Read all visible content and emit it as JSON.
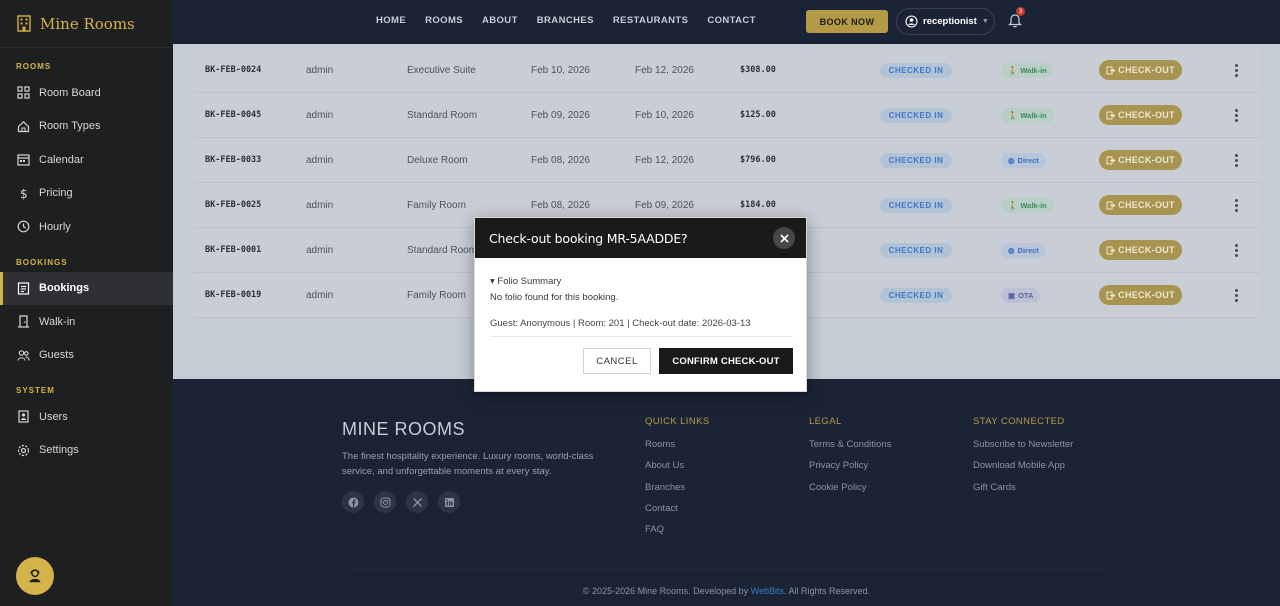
{
  "brand": {
    "name": "Mine Rooms"
  },
  "sidebar": {
    "sections": [
      {
        "label": "ROOMS",
        "items": [
          {
            "label": "Room Board",
            "icon": "grid-icon"
          },
          {
            "label": "Room Types",
            "icon": "home-icon"
          },
          {
            "label": "Calendar",
            "icon": "calendar-icon"
          },
          {
            "label": "Pricing",
            "icon": "dollar-icon"
          },
          {
            "label": "Hourly",
            "icon": "clock-icon"
          }
        ]
      },
      {
        "label": "BOOKINGS",
        "items": [
          {
            "label": "Bookings",
            "icon": "list-icon",
            "active": true
          },
          {
            "label": "Walk-in",
            "icon": "door-icon"
          },
          {
            "label": "Guests",
            "icon": "users-icon"
          }
        ]
      },
      {
        "label": "SYSTEM",
        "items": [
          {
            "label": "Users",
            "icon": "user-card-icon"
          },
          {
            "label": "Settings",
            "icon": "gear-icon"
          }
        ]
      }
    ]
  },
  "topnav": {
    "links": [
      "HOME",
      "ROOMS",
      "ABOUT",
      "BRANCHES",
      "RESTAURANTS",
      "CONTACT"
    ],
    "book_now": "BOOK NOW",
    "user": "receptionist",
    "notifications": "3"
  },
  "bookings": [
    {
      "code": "BK-FEB-0024",
      "user": "admin",
      "room": "Executive Suite",
      "check_in": "Feb 10, 2026",
      "check_out": "Feb 12, 2026",
      "amount": "$308.00",
      "status": "CHECKED IN",
      "source": "Walk-in",
      "source_type": "walk",
      "action": "CHECK-OUT"
    },
    {
      "code": "BK-FEB-0045",
      "user": "admin",
      "room": "Standard Room",
      "check_in": "Feb 09, 2026",
      "check_out": "Feb 10, 2026",
      "amount": "$125.00",
      "status": "CHECKED IN",
      "source": "Walk-in",
      "source_type": "walk",
      "action": "CHECK-OUT"
    },
    {
      "code": "BK-FEB-0033",
      "user": "admin",
      "room": "Deluxe Room",
      "check_in": "Feb 08, 2026",
      "check_out": "Feb 12, 2026",
      "amount": "$796.00",
      "status": "CHECKED IN",
      "source": "Direct",
      "source_type": "direct",
      "action": "CHECK-OUT"
    },
    {
      "code": "BK-FEB-0025",
      "user": "admin",
      "room": "Family Room",
      "check_in": "Feb 08, 2026",
      "check_out": "Feb 09, 2026",
      "amount": "$184.00",
      "status": "CHECKED IN",
      "source": "Walk-in",
      "source_type": "walk",
      "action": "CHECK-OUT"
    },
    {
      "code": "BK-FEB-0001",
      "user": "admin",
      "room": "Standard Room",
      "check_in": "",
      "check_out": "",
      "amount": "",
      "status": "CHECKED IN",
      "source": "Direct",
      "source_type": "direct",
      "action": "CHECK-OUT"
    },
    {
      "code": "BK-FEB-0019",
      "user": "admin",
      "room": "Family Room",
      "check_in": "",
      "check_out": "",
      "amount": "",
      "status": "CHECKED IN",
      "source": "OTA",
      "source_type": "ota",
      "action": "CHECK-OUT"
    }
  ],
  "modal": {
    "title": "Check-out booking MR-5AADDE?",
    "folio_summary": "▾ Folio Summary",
    "folio_note": "No folio found for this booking.",
    "guest_line": "Guest: Anonymous | Room: 201 | Check-out date: 2026-03-13",
    "cancel": "CANCEL",
    "confirm": "CONFIRM CHECK-OUT"
  },
  "footer": {
    "brand": "MINE ROOMS",
    "description": "The finest hospitality experience. Luxury rooms, world-class service, and unforgettable moments at every stay.",
    "socials": [
      "facebook-icon",
      "instagram-icon",
      "x-icon",
      "linkedin-icon"
    ],
    "columns": [
      {
        "title": "QUICK LINKS",
        "links": [
          "Rooms",
          "About Us",
          "Branches",
          "Contact",
          "FAQ"
        ]
      },
      {
        "title": "LEGAL",
        "links": [
          "Terms & Conditions",
          "Privacy Policy",
          "Cookie Policy"
        ]
      },
      {
        "title": "STAY CONNECTED",
        "links": [
          "Subscribe to Newsletter",
          "Download Mobile App",
          "Gift Cards"
        ]
      }
    ],
    "copyright_prefix": "© 2025-2026 Mine Rooms. Developed by ",
    "developer": "WebBits",
    "copyright_suffix": ". All Rights Reserved."
  },
  "colors": {
    "accent": "#d4b44a",
    "sidebar": "#1e1f21",
    "navy": "#1b2436"
  }
}
